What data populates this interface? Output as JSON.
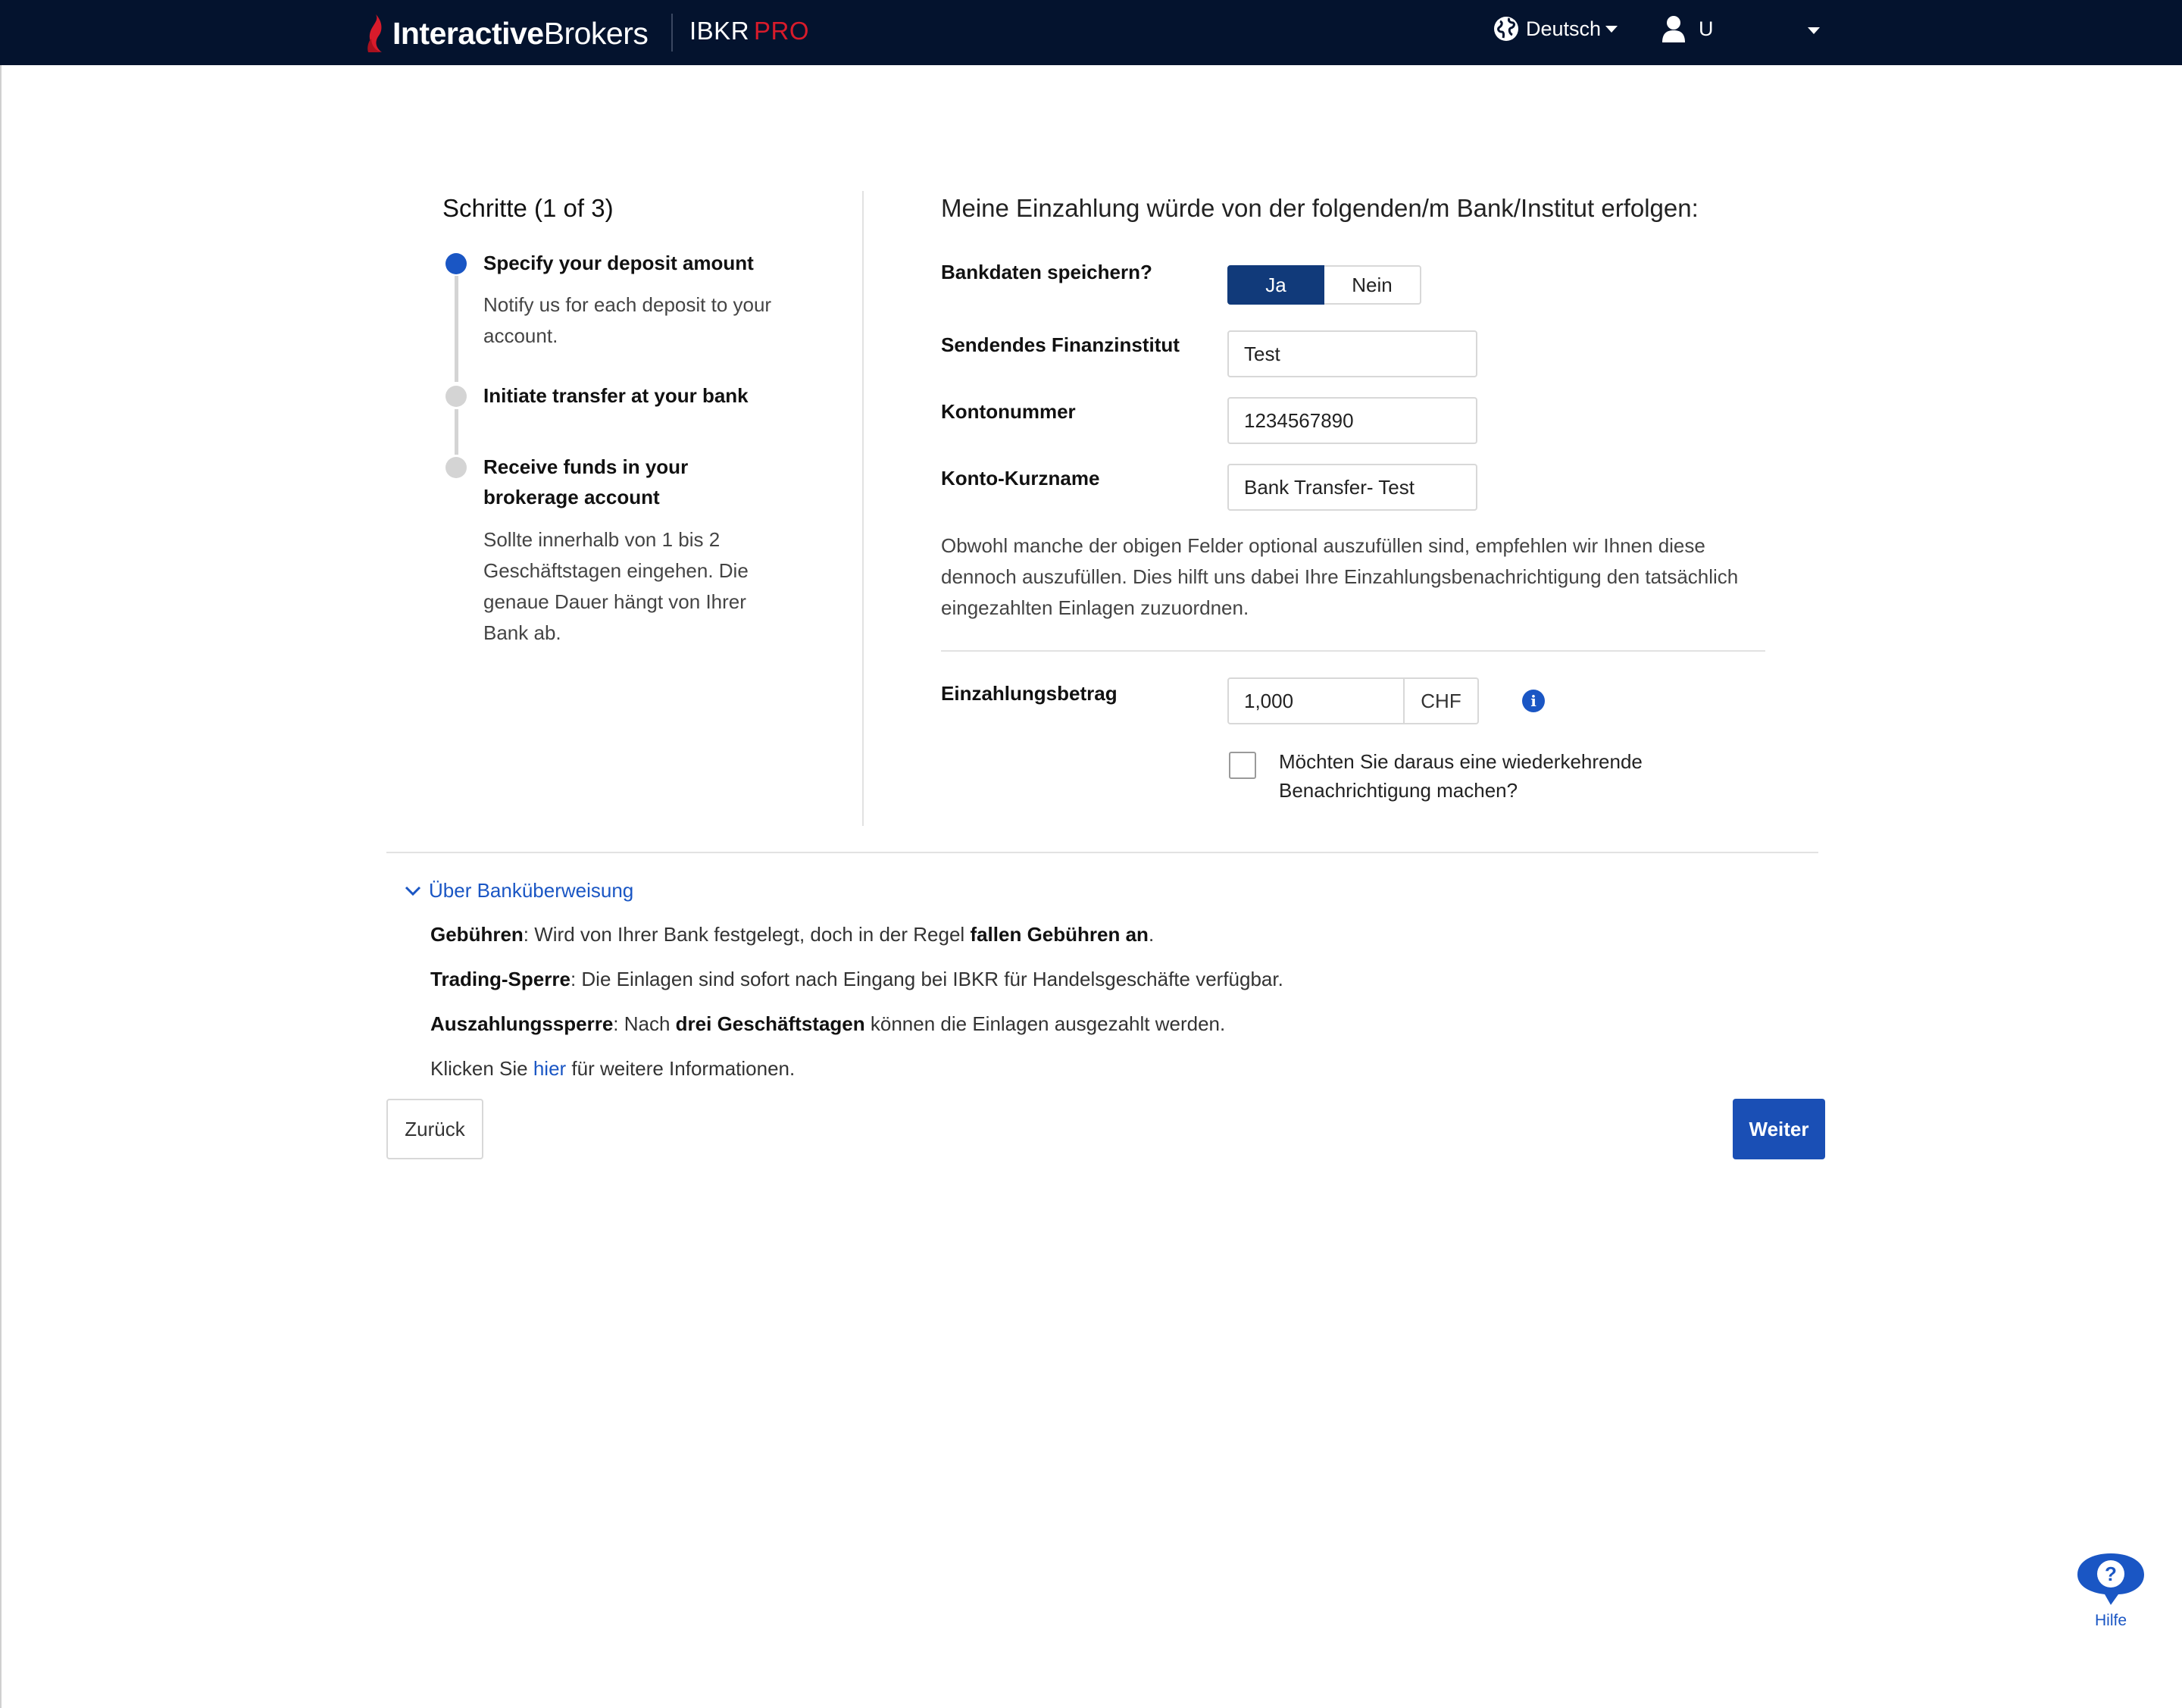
{
  "navbar": {
    "brand_bold": "Interactive",
    "brand_regular": "Brokers",
    "product": "IBKR",
    "product_accent": "PRO",
    "language": "Deutsch",
    "user": "U"
  },
  "steps": {
    "title": "Schritte (1 of 3)",
    "items": [
      {
        "title": "Specify your deposit amount",
        "desc": "Notify us for each deposit to your account."
      },
      {
        "title": "Initiate transfer at your bank",
        "desc": ""
      },
      {
        "title": "Receive funds in your brokerage account",
        "desc": "Sollte innerhalb von 1 bis 2 Geschäftstagen eingehen. Die genaue Dauer hängt von Ihrer Bank ab."
      }
    ]
  },
  "form": {
    "heading": "Meine Einzahlung würde von der folgenden/m Bank/Institut erfolgen:",
    "save_bank_label": "Bankdaten speichern?",
    "toggle_yes": "Ja",
    "toggle_no": "Nein",
    "toggle_selected": "Ja",
    "institution_label": "Sendendes Finanzinstitut",
    "institution_value": "Test",
    "account_label": "Kontonummer",
    "account_value": "1234567890",
    "shortname_label": "Konto-Kurzname",
    "shortname_value": "Bank Transfer- Test",
    "note": "Obwohl manche der obigen Felder optional auszufüllen sind, empfehlen wir Ihnen diese dennoch auszufüllen. Dies hilft uns dabei Ihre Einzahlungsbenachrichtigung den tatsächlich eingezahlten Einlagen zuzuordnen.",
    "amount_label": "Einzahlungsbetrag",
    "amount_value": "1,000",
    "currency": "CHF",
    "info_icon": "i",
    "recurring_label": "Möchten Sie daraus eine wiederkehrende Benachrichtigung machen?",
    "recurring_checked": false
  },
  "about": {
    "toggle": "Über Banküberweisung",
    "fees_label": "Gebühren",
    "fees_text": ": Wird von Ihrer Bank festgelegt, doch in der Regel ",
    "fees_bold": "fallen Gebühren an",
    "fees_end": ".",
    "trading_label": "Trading-Sperre",
    "trading_text": ": Die Einlagen sind sofort nach Eingang bei IBKR für Handelsgeschäfte verfügbar.",
    "withdraw_label": "Auszahlungssperre",
    "withdraw_text": ": Nach ",
    "withdraw_bold": "drei Geschäftstagen",
    "withdraw_end": " können die Einlagen ausgezahlt werden.",
    "more_pre": "Klicken Sie ",
    "more_link": "hier",
    "more_post": " für weitere Informationen."
  },
  "buttons": {
    "back": "Zurück",
    "next": "Weiter"
  },
  "help": {
    "label": "Hilfe",
    "icon_glyph": "?"
  },
  "colors": {
    "navbar": "#04132e",
    "accent": "#1a56c4",
    "brand_red": "#d81b2b",
    "toggle_active": "#113a7a"
  }
}
